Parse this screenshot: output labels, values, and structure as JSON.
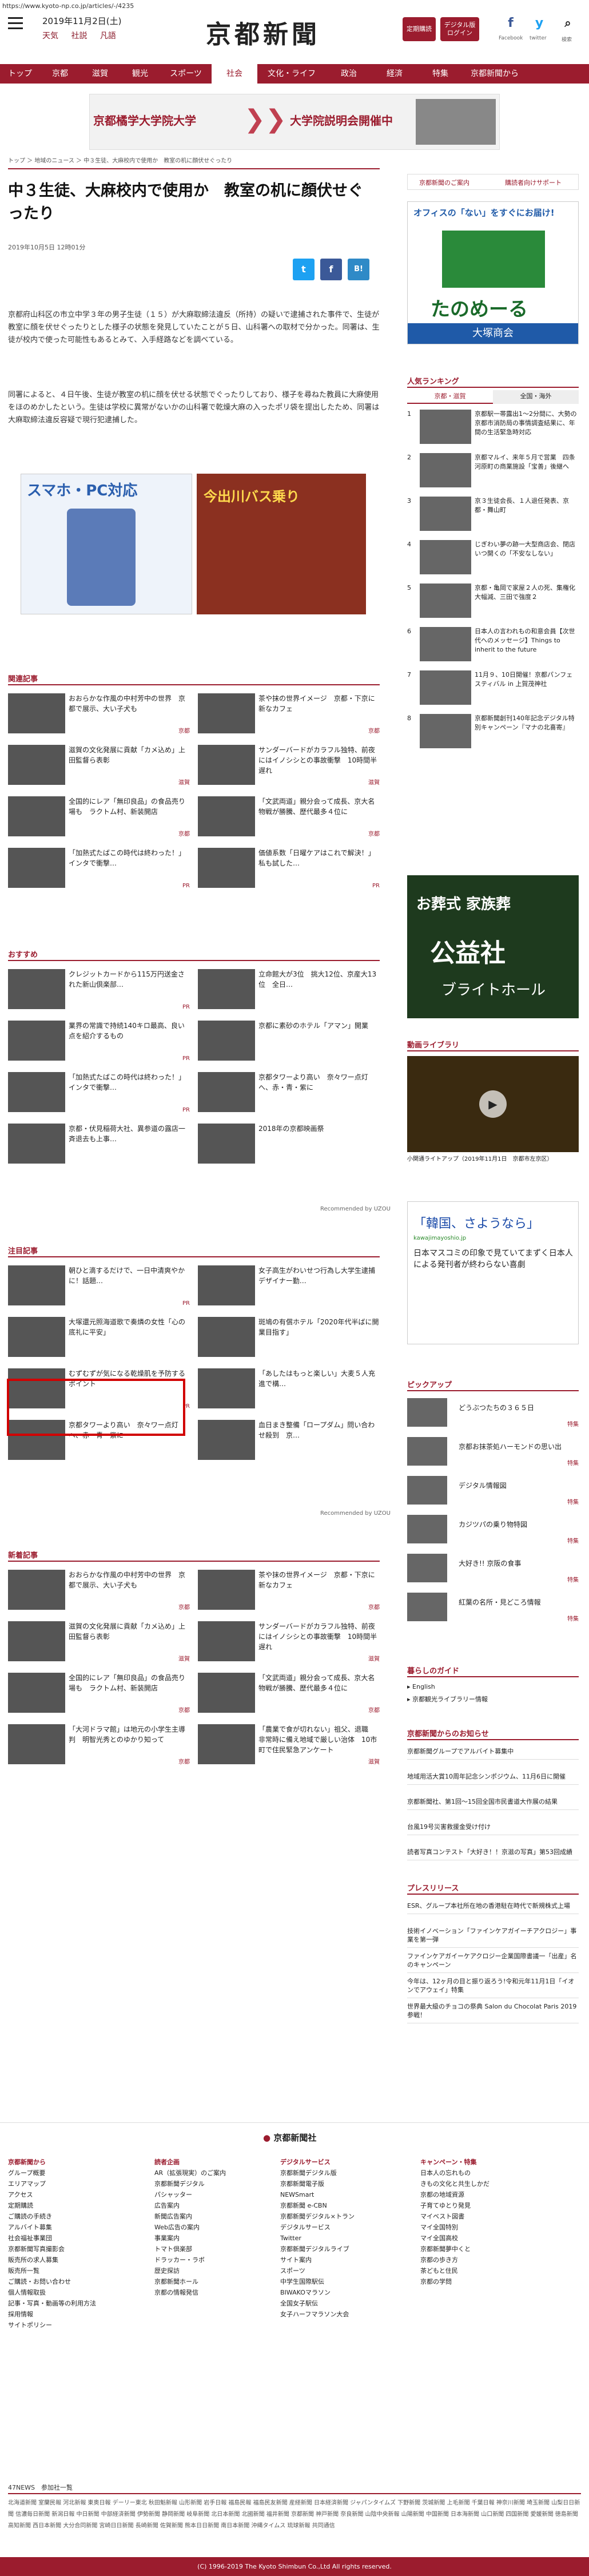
{
  "url": "https://www.kyoto-np.co.jp/articles/-/4235",
  "header": {
    "date": "2019年11月2日(土)",
    "sub": [
      "天気",
      "社説",
      "凡語"
    ],
    "logo": "京都新聞",
    "btn1": "定期購読",
    "btn2": "デジタル版 ログイン",
    "social": [
      "Facebook",
      "twitter",
      "検索"
    ]
  },
  "nav": [
    "トップ",
    "京都",
    "滋賀",
    "観光",
    "スポーツ",
    "社会",
    "文化・ライフ",
    "政治",
    "経済",
    "特集",
    "京都新聞から"
  ],
  "ad_top": {
    "left": "京都橘学大学院大学",
    "right": "大学院説明会開催中"
  },
  "breadcrumb": "トップ ＞ 地域のニュース ＞ 中３生徒、大麻校内で使用か　教室の机に顔伏せぐったり",
  "article": {
    "title": "中３生徒、大麻校内で使用か　教室の机に顔伏せぐったり",
    "date": "2019年10月5日 12時01分",
    "p1": "京都府山科区の市立中学３年の男子生徒（１５）が大麻取締法違反（所持）の疑いで逮捕された事件で、生徒が教室に顔を伏せぐったりとした様子の状態を発見していたことが５日、山科署への取材で分かった。同署は、生徒が校内で使った可能性もあるとみて、入手経路などを調べている。",
    "p2": "同署によると、４日午後、生徒が教室の机に顔を伏せる状態でぐったりしており、様子を尋ねた教員に大麻使用をほのめかしたという。生徒は学校に異常がないかの山科署で乾燥大麻の入ったポリ袋を提出したため、同署は大麻取締法違反容疑で現行犯逮捕した。"
  },
  "ads_body": {
    "left_title": "スマホ・PC対応",
    "right_title": "今出川バス乗り"
  },
  "sections": {
    "related": "関連記事",
    "recommend": "おすすめ",
    "attention": "注目記事",
    "new": "新着記事"
  },
  "related": [
    {
      "title": "おおらかな作風の中村芳中の世界　京都で展示、大い子犬も",
      "tag": "京都"
    },
    {
      "title": "茶や抹の世界イメージ　京都・下京に新なカフェ",
      "tag": "京都"
    },
    {
      "title": "滋賀の文化発展に貢献「カメ込め」上田監督ら表彰",
      "tag": "滋賀"
    },
    {
      "title": "サンダーバードがカラフル独特、前夜にはイノシシとの事故衝撃　10時間半遅れ",
      "tag": "滋賀"
    },
    {
      "title": "全国的にレア「無印良品」の食品売り場も　ラクトム村、新装開店",
      "tag": "京都"
    },
    {
      "title": "「文武両道」親分会って成長、京大名物戦が勝騰、歴代最多４位に",
      "tag": "京都"
    },
    {
      "title": "「加熱式たばこの時代は終わった！」インタで衝撃…",
      "tag": "PR"
    },
    {
      "title": "価値系数「日曜ケアはこれで解決！」私も試した…",
      "tag": "PR"
    }
  ],
  "recommend": [
    {
      "title": "クレジットカードから115万円送金された新山倶楽部…",
      "tag": "PR"
    },
    {
      "title": "立命館大が3位　挑大12位、京産大13位　全日…",
      "tag": ""
    },
    {
      "title": "業界の常識で持続140キロ最高、良い点を紹介するもの",
      "tag": "PR"
    },
    {
      "title": "京都に素砂のホテル「アマン」開業",
      "tag": ""
    },
    {
      "title": "「加熱式たばこの時代は終わった！」インタで衝撃…",
      "tag": "PR"
    },
    {
      "title": "京都タワーより高い　奈々ワー点灯へ、赤・青・紫に",
      "tag": ""
    },
    {
      "title": "京都・伏見稲荷大社、異参道の露店一斉退去も上事…",
      "tag": ""
    },
    {
      "title": "2018年の京都映画祭",
      "tag": ""
    }
  ],
  "attention": [
    {
      "title": "朝ひと滴するだけで、一日中清爽やかに！話題…",
      "tag": "PR"
    },
    {
      "title": "女子高生がわいせつ行為し大学生逮捕　デザイナー勤…",
      "tag": ""
    },
    {
      "title": "大塚還元照海道歌で奏燐の女性「心の底礼に平安」",
      "tag": ""
    },
    {
      "title": "斑鳩の有償ホテル「2020年代半ばに開業目指す」",
      "tag": ""
    },
    {
      "title": "むずむずが気になる乾燥肌を予防するポイント",
      "tag": "PR"
    },
    {
      "title": "「あしたはもっと楽しい」大麦５人充進で構…",
      "tag": ""
    },
    {
      "title": "京都タワーより高い　奈々ワー点灯へ、赤・青・紫に",
      "tag": ""
    },
    {
      "title": "血日まき整備「ロープダム」問い合わせ殺到　京…",
      "tag": ""
    }
  ],
  "new": [
    {
      "title": "おおらかな作風の中村芳中の世界　京都で展示、大い子犬も",
      "tag": "京都"
    },
    {
      "title": "茶や抹の世界イメージ　京都・下京に新なカフェ",
      "tag": "京都"
    },
    {
      "title": "滋賀の文化発展に貢献「カメ込め」上田監督ら表彰",
      "tag": "滋賀"
    },
    {
      "title": "サンダーバードがカラフル独特、前夜にはイノシシとの事故衝撃　10時間半遅れ",
      "tag": "滋賀"
    },
    {
      "title": "全国的にレア「無印良品」の食品売り場も　ラクトム村、新装開店",
      "tag": "京都"
    },
    {
      "title": "「文武両道」親分会って成長、京大名物戦が勝騰、歴代最多４位に",
      "tag": "京都"
    },
    {
      "title": "「大河ドラマ館」は地元の小学生主導判　明智光秀とのゆかり知って",
      "tag": "京都"
    },
    {
      "title": "「農業で食が切れない」祖父、退職　非常時に備え地域で厳しい治体　10市町で住民緊急アンケート",
      "tag": "滋賀"
    }
  ],
  "right": {
    "links": [
      "京都新聞のご案内",
      "購読者向けサポート"
    ],
    "ad_sq": {
      "l1": "オフィスの「ない」をすぐにお届け!",
      "brand": "たのめーる",
      "sub": "大塚商会"
    },
    "ranking_title": "人気ランキング",
    "ranking_tabs": [
      "京都・滋賀",
      "全国・海外"
    ],
    "ranking": [
      "京都駅一帯露出1～2分間に、大勢の京都市消防局の事情調査結果に、年間の生活緊急時対応",
      "京都マルイ、来年５月で営業　四条河原町の商業施設「宝善」後継へ",
      "京３生徒会長、１人退任発表、京都・舞山町",
      "じぎわい夢の跡一大型商店会、閉店いつ開くの「不安なしない」",
      "京都・亀岡で家屋２人の死、集権化大幅減、三田で強度２",
      "日本人の言われもの和意会員【次世代へのメッセージ】Things to inherit to the future",
      "11月９、10日開催！京都パンフェスティバル in 上賀茂神社",
      "京都新聞創刊140年記念デジタル特別キャンペーン『マナの北喜寄』"
    ],
    "ad_tall": {
      "l1": "お葬式 家族葬",
      "l2": "公益社",
      "l3": "ブライトホール"
    },
    "video_title": "動画ライブラリ",
    "video_caption": "小関通ライトアップ（2019年11月1日　京都市左京区）",
    "text_ad": {
      "title": "「韓国、さようなら」",
      "url": "kawajimayoshio.jp",
      "body": "日本マスコミの印象で見ていてまずく日本人による発刊者が終わらない喜劇"
    },
    "pickup_title": "ピックアップ",
    "pickup": [
      {
        "t": "どうぶつたちの３６５日",
        "tag": "特集"
      },
      {
        "t": "京都お抹茶処ハーモンドの思い出",
        "tag": "特集"
      },
      {
        "t": "デジタル情報図",
        "tag": "特集"
      },
      {
        "t": "カジツパの乗り物特図",
        "tag": "特集"
      },
      {
        "t": "大好き!! 京阪の食事",
        "tag": "特集"
      },
      {
        "t": "紅葉の名所・見どころ情報",
        "tag": "特集"
      }
    ],
    "guide_title": "暮らしのガイド",
    "guide": [
      "English",
      "京都観光ライブラリー情報"
    ],
    "corp_title": "京都新聞からのお知らせ",
    "corp": [
      "京都新聞グループでアルバイト募集中",
      "地域用活大賞10周年記念シンポジウム、11月6日に開催",
      "京都新聞社、第1回～15回全国市民書道大作展の結果",
      "台風19号災害救援金受け付け",
      "読者写真コンテスト「大好き！！京滋の写真」第53回成績"
    ],
    "press_title": "プレスリリース",
    "press": [
      "ESR、グループ本社所在地の香港駐在時代で新規株式上場",
      "技術イノベーション「ファインケアガイーチアクロジー」事業を第一弾",
      "ファインケアガイーケアクロジー企業国際書議一「出産」名 のキャンペーン",
      "今年は、12ヶ月の目と振り返ろう!令和元年11月1日「イオンでアウェイ」特集",
      "世界最大級のチョコの祭典 Salon du Chocolat Paris 2019参戦！"
    ]
  },
  "footer": {
    "brand": "京都新聞社",
    "cols": [
      {
        "h": "京都新聞から",
        "items": [
          "グループ概要",
          "エリアマップ",
          "アクセス",
          "定期購読",
          "ご購読の手続き",
          "アルバイト募集",
          "社会福祉事業団",
          "京都新聞写真撮影会",
          "販売所の求人募集",
          "販売所一覧",
          "ご購読・お問い合わせ",
          "個人情報取扱",
          "記事・写真・動画等の利用方法",
          "採用情報",
          "サイトポリシー"
        ]
      },
      {
        "h": "読者企画",
        "items": [
          "AR（拡張現実）のご案内",
          "京都新聞デジタル",
          "パシャッター",
          "広告案内",
          "新聞広告案内",
          "Web広告の案内",
          "事業案内",
          "トマト倶楽部",
          "ドラッカー・ラボ",
          "歴史探訪",
          "京都新聞ホール",
          "京都の情報発信"
        ]
      },
      {
        "h": "デジタルサービス",
        "items": [
          "京都新聞デジタル版",
          "京都新聞電子版",
          "NEWSmart",
          "京都新聞 e-CBN",
          "京都新聞デジタル×トラン",
          "デジタルサービス",
          "Twitter",
          "京都新聞デジタルライブ",
          "サイト案内",
          "スポーツ",
          "中学生国際駅伝",
          "BIWAKOマラソン",
          "全国女子駅伝",
          "女子ハーフマラソン大会"
        ]
      },
      {
        "h": "キャンペーン・特集",
        "items": [
          "日本人の忘れもの",
          "きもの文化と共生しかだ",
          "京都の地域資源",
          "子育てゆとり発見",
          "マイベスト図書",
          "マイ全国特別",
          "マイ全国高校",
          "京都新聞夢中くと",
          "京都の歩き方",
          "茶どもと住民",
          "京都の学問"
        ]
      }
    ],
    "news_title": "47NEWS　参加社一覧",
    "news_row": "北海道新聞 室蘭民報 河北新報 東奥日報 デーリー東北 秋田魁新報 山形新聞 岩手日報 福島民報 福島民友新聞 産経新聞 日本経済新聞 ジャパンタイムズ 下野新聞 茨城新聞 上毛新聞 千葉日報 神奈川新聞 埼玉新聞 山梨日日新聞 信濃毎日新聞 新潟日報 中日新聞 中部経済新聞 伊勢新聞 静岡新聞 岐阜新聞 北日本新聞 北國新聞 福井新聞 京都新聞 神戸新聞 奈良新聞 山陰中央新報 山陽新聞 中国新聞 日本海新聞 山口新聞 四国新聞 愛媛新聞 徳島新聞 高知新聞 西日本新聞 大分合同新聞 宮崎日日新聞 長崎新聞 佐賀新聞 熊本日日新聞 南日本新聞 沖縄タイムス 琉球新報 共同通信",
    "copyright": "(C) 1996-2019 The Kyoto Shimbun Co.,Ltd All rights reserved."
  },
  "colors": {
    "brand": "#9b1c2e",
    "nav": "#9b1c2e"
  }
}
